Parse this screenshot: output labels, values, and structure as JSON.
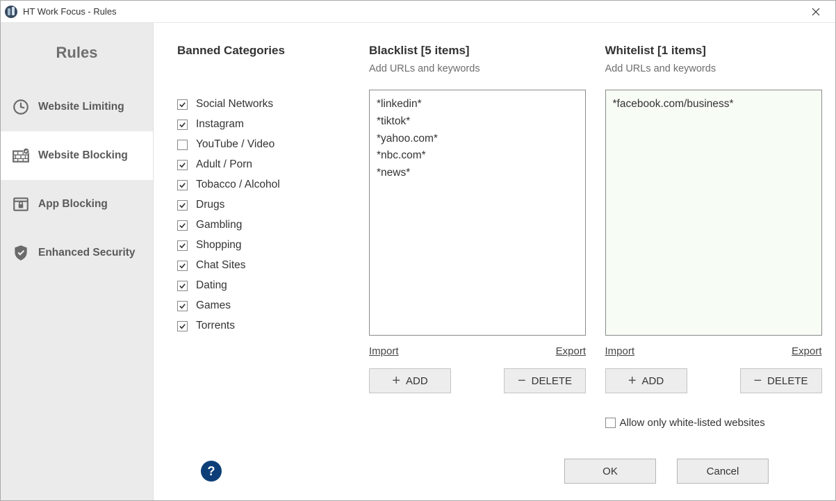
{
  "window": {
    "title": "HT Work Focus - Rules"
  },
  "sidebar": {
    "heading": "Rules",
    "items": [
      {
        "label": "Website Limiting",
        "active": false
      },
      {
        "label": "Website Blocking",
        "active": true
      },
      {
        "label": "App Blocking",
        "active": false
      },
      {
        "label": "Enhanced Security",
        "active": false
      }
    ]
  },
  "categories": {
    "title": "Banned Categories",
    "items": [
      {
        "label": "Social Networks",
        "checked": true
      },
      {
        "label": "Instagram",
        "checked": true
      },
      {
        "label": "YouTube / Video",
        "checked": false
      },
      {
        "label": "Adult / Porn",
        "checked": true
      },
      {
        "label": "Tobacco / Alcohol",
        "checked": true
      },
      {
        "label": "Drugs",
        "checked": true
      },
      {
        "label": "Gambling",
        "checked": true
      },
      {
        "label": "Shopping",
        "checked": true
      },
      {
        "label": "Chat Sites",
        "checked": true
      },
      {
        "label": "Dating",
        "checked": true
      },
      {
        "label": "Games",
        "checked": true
      },
      {
        "label": "Torrents",
        "checked": true
      }
    ]
  },
  "blacklist": {
    "title": "Blacklist [5 items]",
    "subtext": "Add URLs and keywords",
    "entries": [
      "*linkedin*",
      "*tiktok*",
      "*yahoo.com*",
      "*nbc.com*",
      "*news*"
    ],
    "import": "Import",
    "export": "Export",
    "add": "ADD",
    "delete": "DELETE"
  },
  "whitelist": {
    "title": "Whitelist [1 items]",
    "subtext": "Add URLs and keywords",
    "entries": [
      "*facebook.com/business*"
    ],
    "import": "Import",
    "export": "Export",
    "add": "ADD",
    "delete": "DELETE",
    "allow_only": {
      "label": "Allow only white-listed websites",
      "checked": false
    }
  },
  "footer": {
    "ok": "OK",
    "cancel": "Cancel"
  }
}
